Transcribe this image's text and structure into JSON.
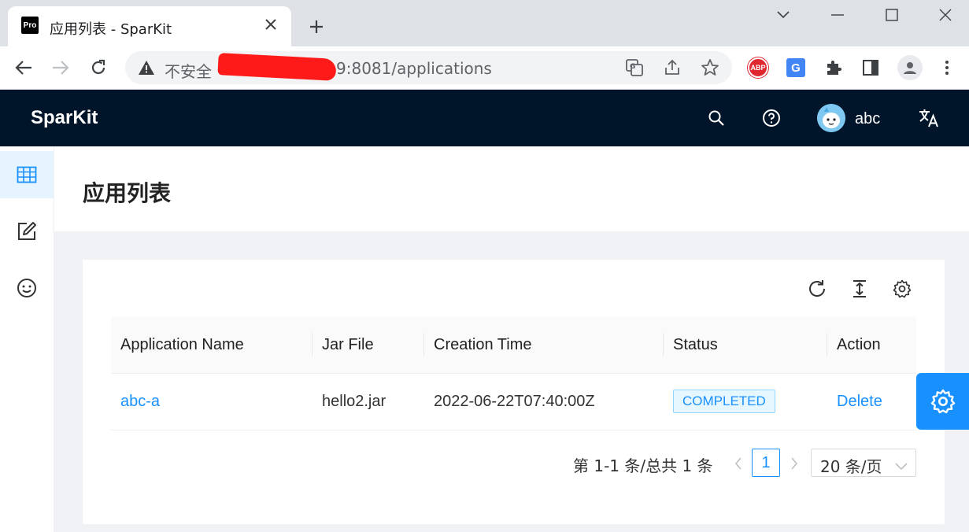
{
  "browser": {
    "tab_title": "应用列表 - SparKit",
    "favicon_text": "Pro",
    "insecure_label": "不安全",
    "url_tail": "9:8081/applications",
    "abp_label": "ABP",
    "gtranslate_label": "G"
  },
  "app": {
    "brand": "SparKit",
    "username": "abc"
  },
  "page": {
    "title": "应用列表"
  },
  "table": {
    "columns": [
      "Application Name",
      "Jar File",
      "Creation Time",
      "Status",
      "Action"
    ],
    "rows": [
      {
        "name": "abc-a",
        "jar": "hello2.jar",
        "created": "2022-06-22T07:40:00Z",
        "status": "COMPLETED",
        "action": "Delete"
      }
    ]
  },
  "pagination": {
    "total_text": "第 1-1 条/总共 1 条",
    "current_page": "1",
    "page_size": "20 条/页"
  },
  "colors": {
    "header_bg": "#001529",
    "accent": "#1890ff",
    "status_tag_bg": "#e6f7ff"
  }
}
